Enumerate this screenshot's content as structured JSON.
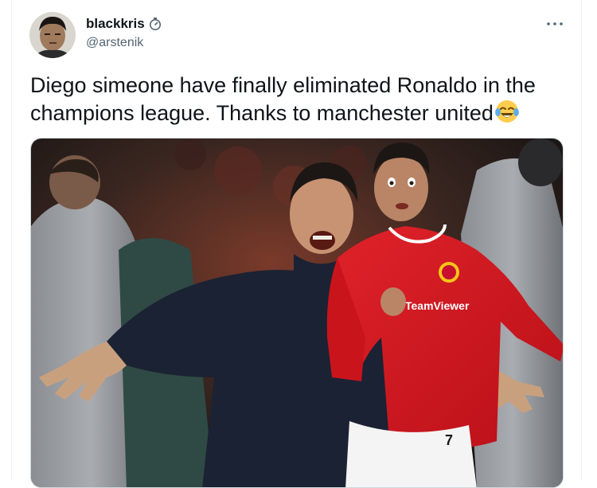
{
  "author": {
    "display_name": "blackkris",
    "handle": "@arstenik",
    "badge_icon": "stopwatch-icon",
    "avatar": "profile-avatar"
  },
  "tweet": {
    "text": "Diego simeone have finally eliminated Ronaldo in the champions league. Thanks to manchester united",
    "emoji": "face-with-tears-of-joy-icon"
  },
  "actions": {
    "more_icon": "more-options-icon"
  },
  "media": {
    "kit_sponsor": "TeamViewer",
    "shirt_number": "7",
    "colors": {
      "shirt_red": "#d7161d",
      "jacket_navy": "#1b2233",
      "background": "#2a2320"
    }
  }
}
